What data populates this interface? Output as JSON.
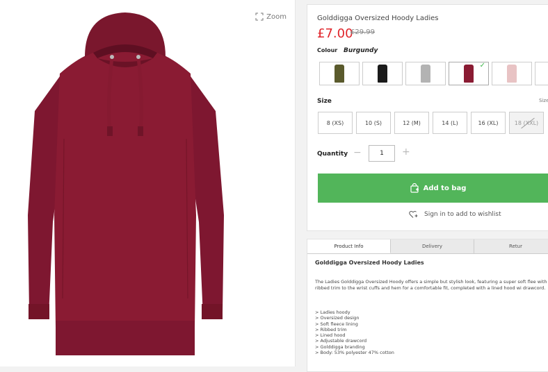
{
  "zoom": {
    "label": "Zoom"
  },
  "product": {
    "title": "Golddigga Oversized Hoody Ladies",
    "price": "£7.00",
    "was_price": "£29.99"
  },
  "colour": {
    "label": "Colour",
    "value": "Burgundy",
    "swatches": [
      {
        "name": "Khaki",
        "color": "#5a5a2c"
      },
      {
        "name": "Black",
        "color": "#1a1a1a"
      },
      {
        "name": "Grey",
        "color": "#b3b3b3"
      },
      {
        "name": "Burgundy",
        "color": "#8a1b33",
        "selected": true
      },
      {
        "name": "Pink",
        "color": "#e8c3c4"
      }
    ]
  },
  "size": {
    "label": "Size",
    "guide": "Size",
    "options": [
      {
        "label": "8 (XS)"
      },
      {
        "label": "10 (S)"
      },
      {
        "label": "12 (M)"
      },
      {
        "label": "14 (L)"
      },
      {
        "label": "16 (XL)"
      },
      {
        "label": "18 (XXL)",
        "out_of_stock": true
      }
    ]
  },
  "quantity": {
    "label": "Quantity",
    "value": "1",
    "minus": "−",
    "plus": "+"
  },
  "actions": {
    "add_to_bag": "Add to bag",
    "wishlist": "Sign in to add to wishlist"
  },
  "tabs": [
    "Product Info",
    "Delivery",
    "Retur"
  ],
  "description": {
    "title": "Golddigga Oversized Hoody Ladies",
    "text": "The Ladies Golddigga Oversized Hoody offers a simple but stylish look, featuring a super soft flee with a ribbed trim to the wrist cuffs and hem for a comfortable fit, completed with a lined hood wi drawcord.",
    "bullets": [
      "> Ladies hoody",
      "> Oversized design",
      "> Soft fleece lining",
      "> Ribbed trim",
      "> Lined hood",
      "> Adjustable drawcord",
      "> Golddigga branding",
      "> Body: 53% polyester 47% cotton"
    ]
  },
  "colors": {
    "accent_green": "#52b55a",
    "price_red": "#e0242a",
    "hoody": "#8a1b33"
  }
}
